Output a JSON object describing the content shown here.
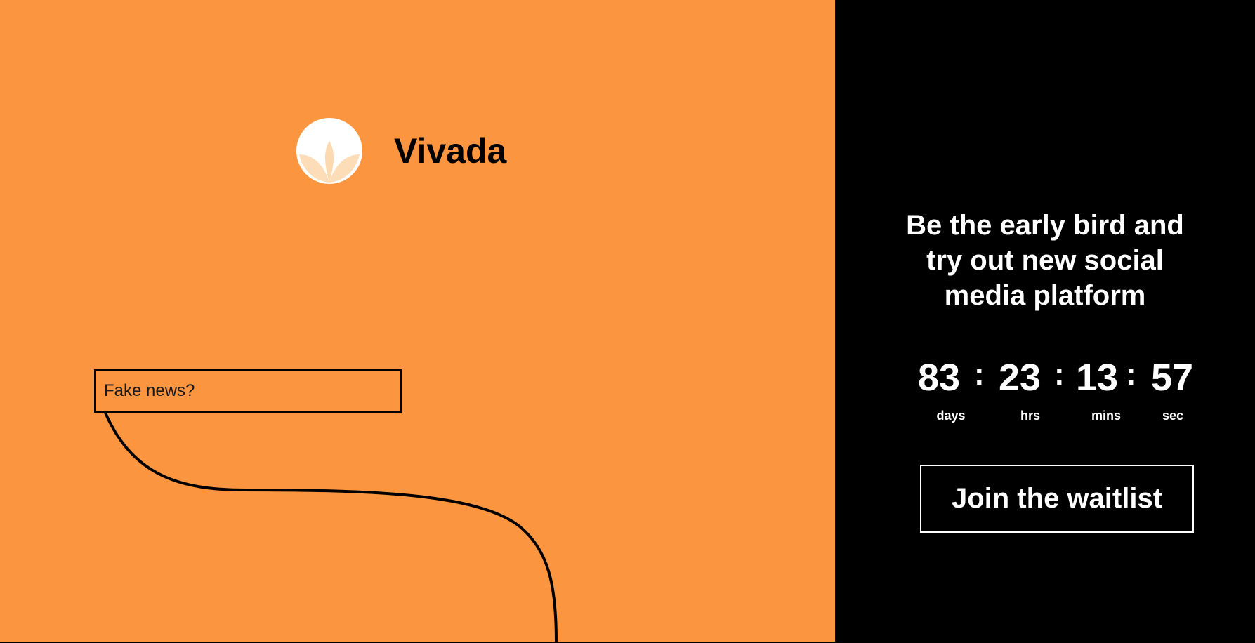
{
  "brand": {
    "name": "Vivada",
    "logo_icon": "lotus-icon"
  },
  "news_box": {
    "text": "Fake news?"
  },
  "headline": {
    "line1": "Be the early bird and",
    "line2": "try out new social",
    "line3": "media platform"
  },
  "countdown": {
    "days": "83",
    "hours": "23",
    "minutes": "13",
    "seconds": "57",
    "separator": ":",
    "days_label": "days",
    "hours_label": "hrs",
    "minutes_label": "mins",
    "seconds_label": "sec"
  },
  "cta": {
    "label": "Join the waitlist"
  },
  "colors": {
    "left_background": "#FC953F",
    "right_background": "#000000",
    "text_light": "#FFFFFF",
    "text_dark": "#000000"
  }
}
